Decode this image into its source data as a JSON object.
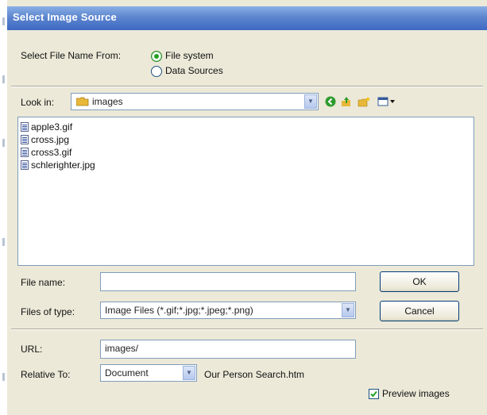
{
  "dialog": {
    "title": "Select Image Source"
  },
  "select_from": {
    "label": "Select File Name From:",
    "options": [
      {
        "label": "File system",
        "checked": true
      },
      {
        "label": "Data Sources",
        "checked": false
      }
    ]
  },
  "look_in": {
    "label": "Look in:",
    "value": "images",
    "toolbar_icons": [
      "back-icon",
      "up-folder-icon",
      "new-folder-icon",
      "view-menu-icon"
    ]
  },
  "files": [
    {
      "name": "apple3.gif"
    },
    {
      "name": "cross.jpg"
    },
    {
      "name": "cross3.gif"
    },
    {
      "name": "schlerighter.jpg"
    }
  ],
  "file_name": {
    "label": "File name:",
    "value": ""
  },
  "files_of_type": {
    "label": "Files of type:",
    "value": "Image Files (*.gif;*.jpg;*.jpeg;*.png)"
  },
  "buttons": {
    "ok": "OK",
    "cancel": "Cancel"
  },
  "url": {
    "label": "URL:",
    "value": "images/"
  },
  "relative_to": {
    "label": "Relative To:",
    "value": "Document",
    "hint": "Our Person Search.htm"
  },
  "preview": {
    "label": "Preview images",
    "checked": true
  },
  "colors": {
    "title_bar": "#3e69c2",
    "dialog_bg": "#ece9d8",
    "radio_checked": "#21a121",
    "back_icon": "#2e9b2e",
    "folder": "#e8b839"
  }
}
